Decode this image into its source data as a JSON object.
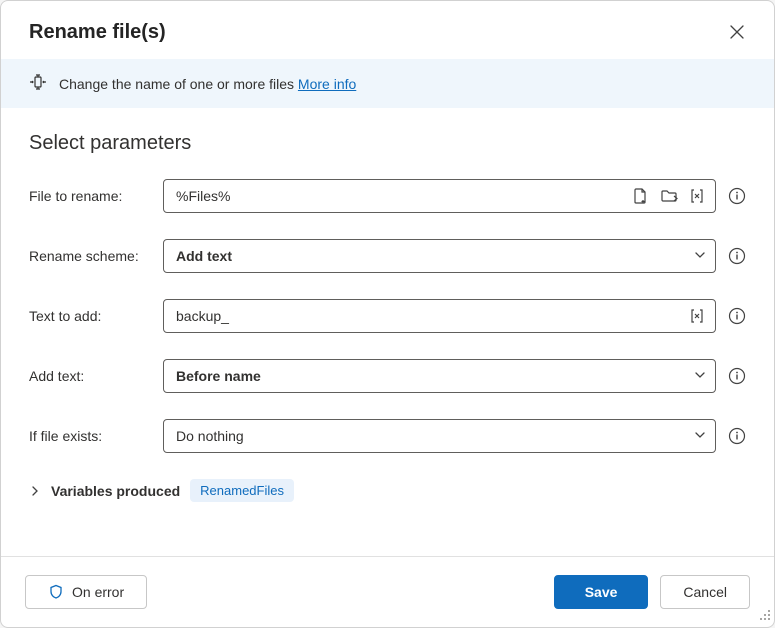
{
  "dialog": {
    "title": "Rename file(s)",
    "info_text": "Change the name of one or more files",
    "more_info": "More info",
    "section_title": "Select parameters"
  },
  "fields": {
    "file_to_rename": {
      "label": "File to rename:",
      "value": "%Files%"
    },
    "rename_scheme": {
      "label": "Rename scheme:",
      "value": "Add text"
    },
    "text_to_add": {
      "label": "Text to add:",
      "value": "backup_"
    },
    "add_text": {
      "label": "Add text:",
      "value": "Before name"
    },
    "if_file_exists": {
      "label": "If file exists:",
      "value": "Do nothing"
    }
  },
  "variables": {
    "label": "Variables produced",
    "chip": "RenamedFiles"
  },
  "footer": {
    "on_error": "On error",
    "save": "Save",
    "cancel": "Cancel"
  }
}
